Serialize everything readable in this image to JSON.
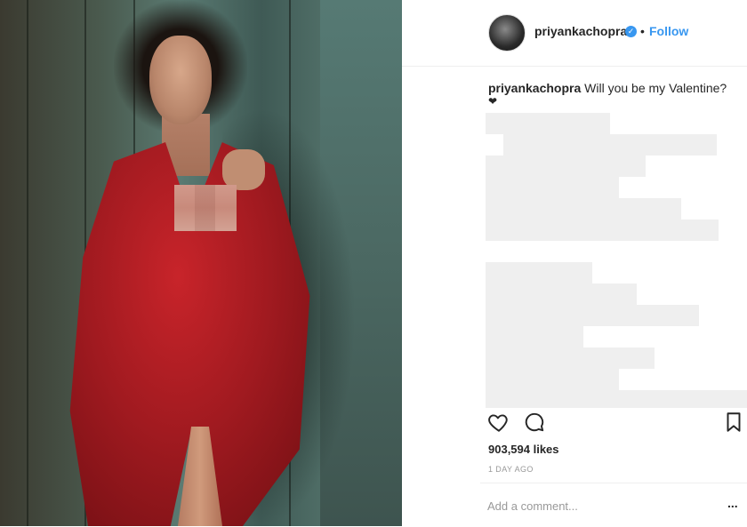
{
  "post": {
    "username": "priyankachopra",
    "follow_label": "Follow",
    "separator": "•",
    "caption_user": "priyankachopra",
    "caption_text": "Will you be my Valentine?",
    "caption_emoji": "❤",
    "likes": "903,594 likes",
    "timestamp": "1 DAY AGO",
    "comment_placeholder": "Add a comment...",
    "more_label": "..."
  },
  "icons": [
    "verified-badge-icon",
    "heart-icon",
    "comment-icon",
    "bookmark-icon",
    "more-options-icon"
  ],
  "colors": {
    "accent": "#3897f0",
    "text": "#262626",
    "muted": "#999999",
    "border": "#efefef",
    "dress": "#a11a20"
  }
}
